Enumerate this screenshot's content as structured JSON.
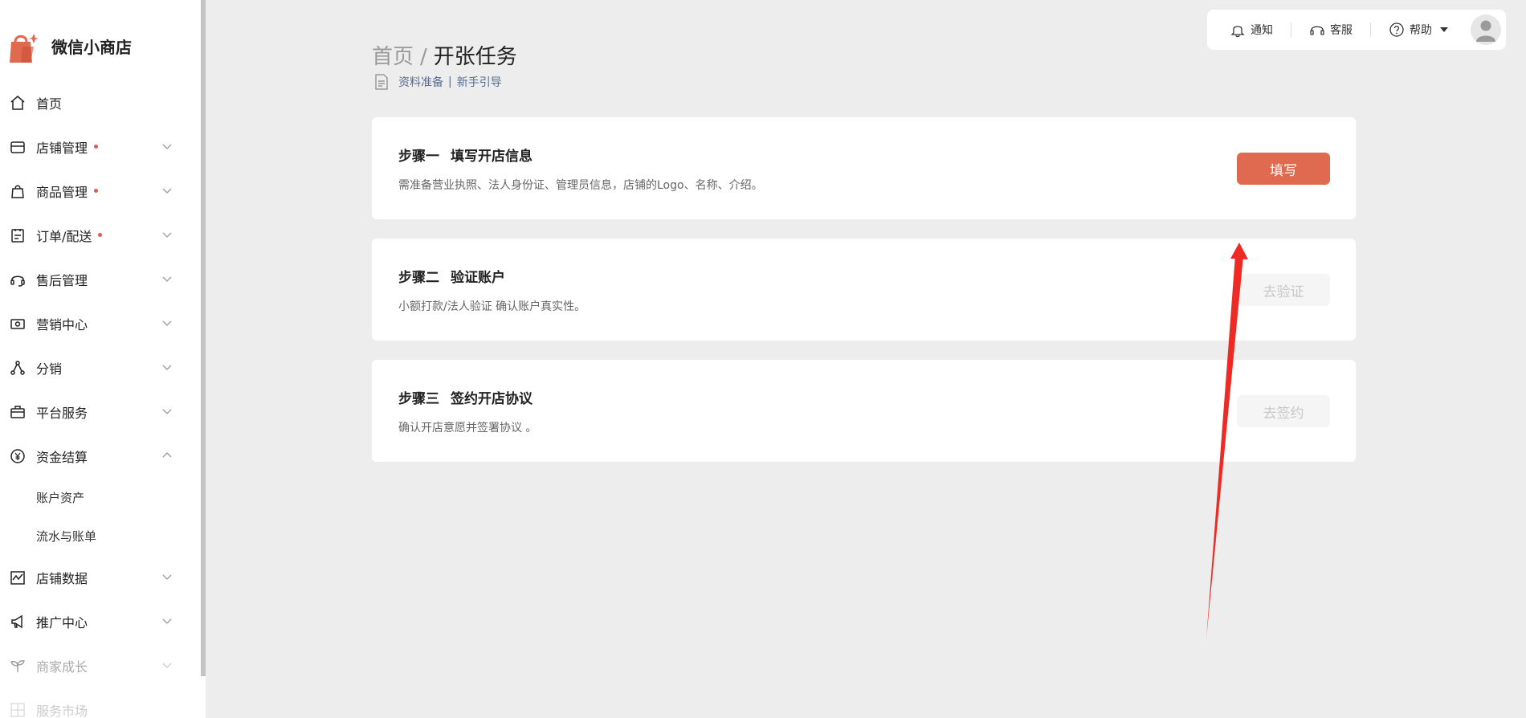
{
  "brand": {
    "name": "微信小商店",
    "accent": "#e06a4f"
  },
  "sidebar": {
    "items": [
      {
        "label": "首页",
        "icon": "home-icon",
        "dot": false,
        "chevron": "none"
      },
      {
        "label": "店铺管理",
        "icon": "store-icon",
        "dot": true,
        "chevron": "down"
      },
      {
        "label": "商品管理",
        "icon": "shopping-bag-icon",
        "dot": true,
        "chevron": "down"
      },
      {
        "label": "订单/配送",
        "icon": "clipboard-icon",
        "dot": true,
        "chevron": "down"
      },
      {
        "label": "售后管理",
        "icon": "headset-icon",
        "dot": false,
        "chevron": "down"
      },
      {
        "label": "营销中心",
        "icon": "ticket-icon",
        "dot": false,
        "chevron": "down"
      },
      {
        "label": "分销",
        "icon": "share-nodes-icon",
        "dot": false,
        "chevron": "down"
      },
      {
        "label": "平台服务",
        "icon": "briefcase-icon",
        "dot": false,
        "chevron": "down"
      },
      {
        "label": "资金结算",
        "icon": "yuan-icon",
        "dot": false,
        "chevron": "up"
      }
    ],
    "sub_items": [
      "账户资产",
      "流水与账单"
    ],
    "items_after": [
      {
        "label": "店铺数据",
        "icon": "chart-icon",
        "chevron": "down"
      },
      {
        "label": "推广中心",
        "icon": "megaphone-icon",
        "chevron": "down"
      },
      {
        "label": "商家成长",
        "icon": "sprout-icon",
        "chevron": "down"
      },
      {
        "label": "服务市场",
        "icon": "grid-icon",
        "chevron": "none"
      }
    ]
  },
  "topbar": {
    "notify": "通知",
    "service": "客服",
    "help": "帮助"
  },
  "header": {
    "breadcrumb_home": "首页",
    "breadcrumb_sep": "/",
    "title": "开张任务",
    "link1": "资料准备",
    "link_sep": "|",
    "link2": "新手引导"
  },
  "steps": [
    {
      "step": "步骤一",
      "title": "填写开店信息",
      "desc": "需准备营业执照、法人身份证、管理员信息，店铺的Logo、名称、介绍。",
      "button": "填写",
      "enabled": true
    },
    {
      "step": "步骤二",
      "title": "验证账户",
      "desc": "小额打款/法人验证 确认账户真实性。",
      "button": "去验证",
      "enabled": false
    },
    {
      "step": "步骤三",
      "title": "签约开店协议",
      "desc": "确认开店意愿并签署协议 。",
      "button": "去签约",
      "enabled": false
    }
  ],
  "colors": {
    "annotation_arrow": "#ee2a24",
    "dot": "#e0594a"
  }
}
